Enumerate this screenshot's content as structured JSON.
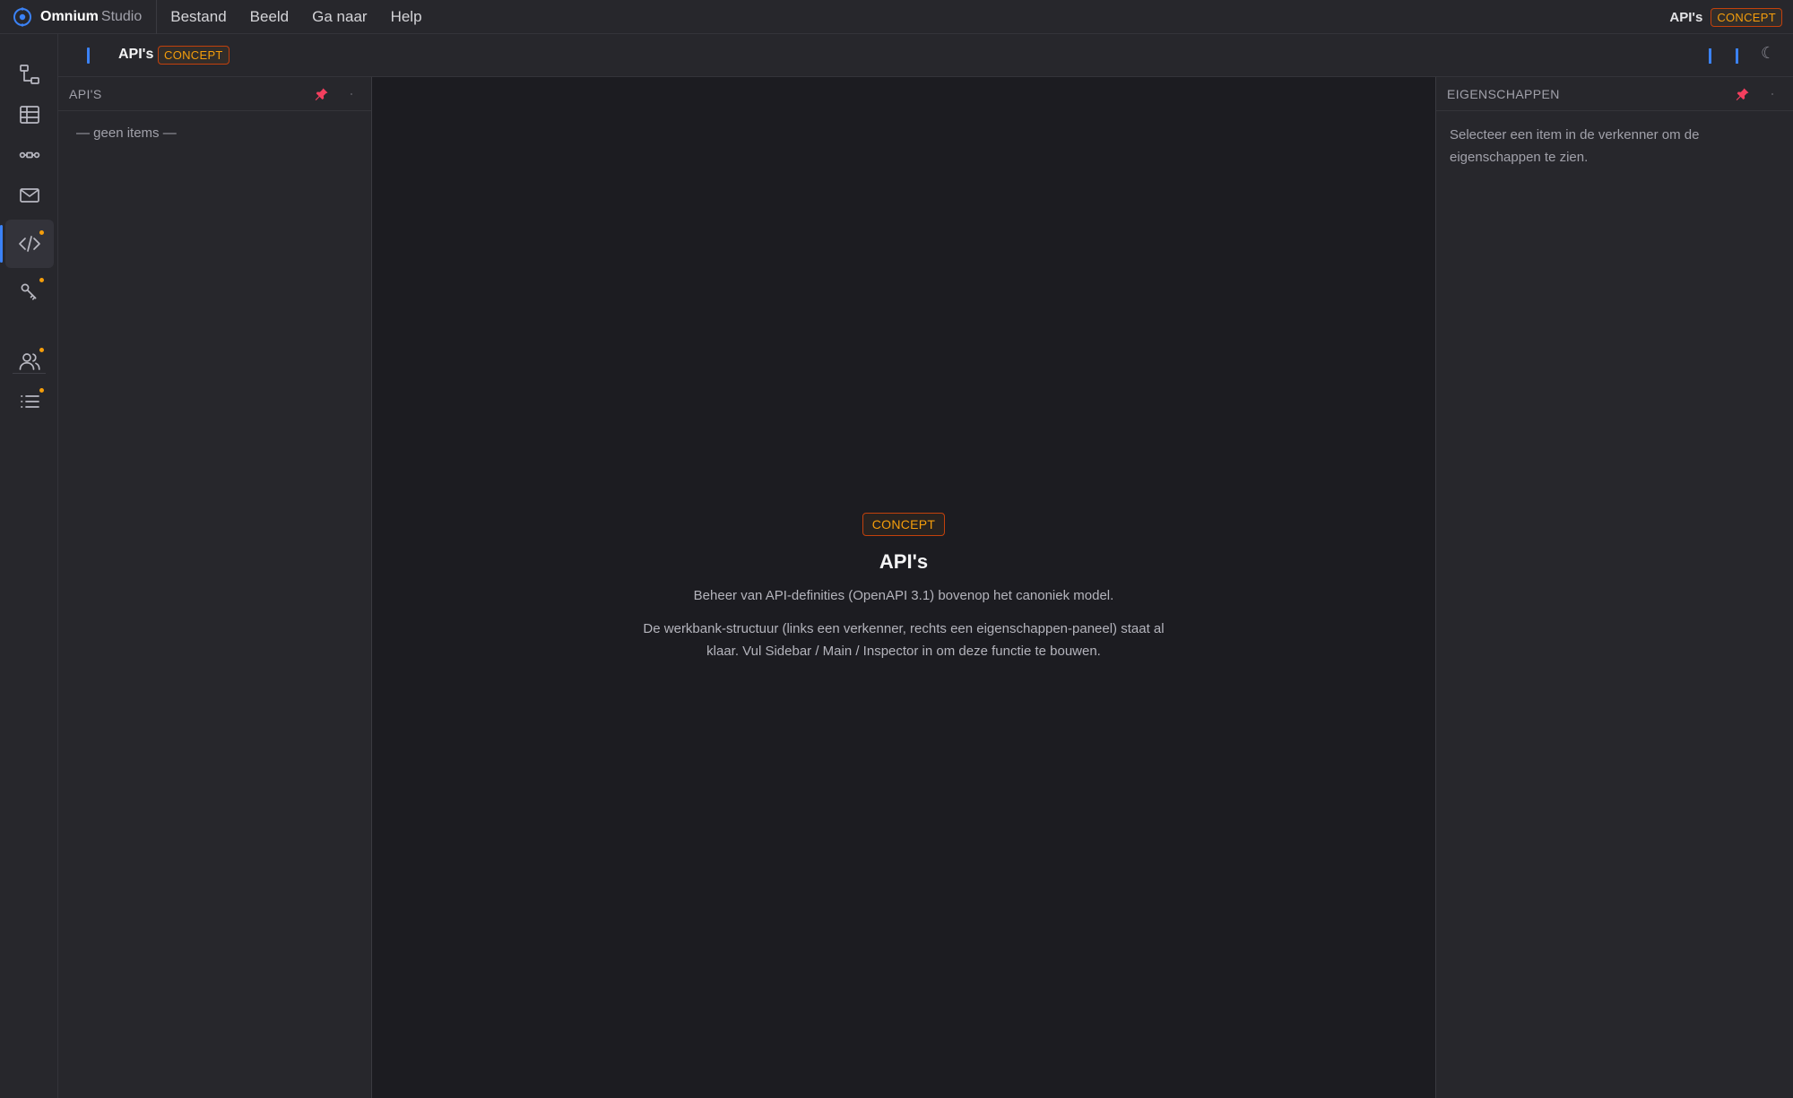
{
  "app": {
    "brand_name": "Omnium",
    "brand_sub": "Studio",
    "menu": [
      {
        "label": "Bestand"
      },
      {
        "label": "Beeld"
      },
      {
        "label": "Ga naar"
      },
      {
        "label": "Help"
      }
    ],
    "current_title": "API's",
    "status_badge": "CONCEPT"
  },
  "activity_bar": {
    "items": [
      {
        "name": "hierarchy-icon",
        "active": false,
        "dot": false
      },
      {
        "name": "table-icon",
        "active": false,
        "dot": false
      },
      {
        "name": "flow-icon",
        "active": false,
        "dot": false
      },
      {
        "name": "mail-icon",
        "active": false,
        "dot": false
      },
      {
        "name": "code-icon",
        "active": true,
        "dot": true
      },
      {
        "name": "key-icon",
        "active": false,
        "dot": true
      },
      {
        "name": "users-icon",
        "active": false,
        "dot": true
      },
      {
        "name": "list-icon",
        "active": false,
        "dot": true
      }
    ]
  },
  "header": {
    "title": "API's",
    "badge": "CONCEPT"
  },
  "sidebar": {
    "title": "API'S",
    "empty_text": "— geen items —"
  },
  "main": {
    "badge": "CONCEPT",
    "title": "API's",
    "description": "Beheer van API-definities (OpenAPI 3.1) bovenop het canoniek model.",
    "note": "De werkbank-structuur (links een verkenner, rechts een eigenschappen-paneel) staat al klaar. Vul Sidebar / Main / Inspector in om deze functie te bouwen."
  },
  "inspector": {
    "title": "EIGENSCHAPPEN",
    "empty_text": "Selecteer een item in de verkenner om de eigenschappen te zien."
  },
  "colors": {
    "accent": "#3b82f6",
    "badge": "#f59e0b",
    "pin": "#f43f5e"
  }
}
